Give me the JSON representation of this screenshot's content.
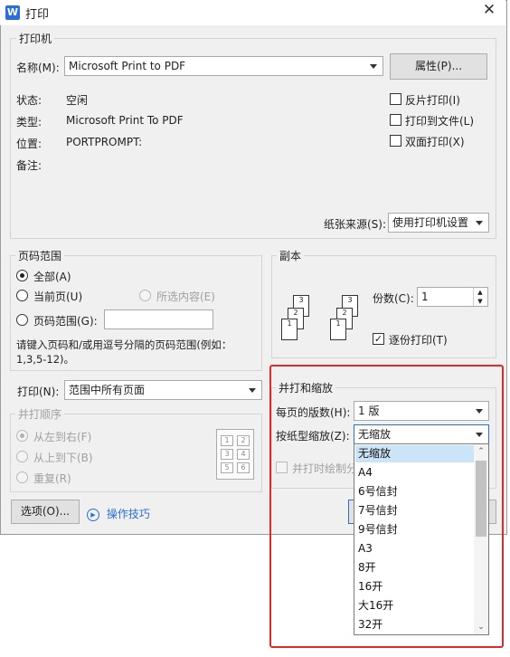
{
  "window": {
    "title": "打印",
    "app_icon": "W",
    "close_glyph": "✕"
  },
  "printer": {
    "group_label": "打印机",
    "name_label": "名称(M):",
    "name_value": "Microsoft Print to PDF",
    "properties_button": "属性(P)...",
    "status_label": "状态:",
    "status_value": "空闲",
    "type_label": "类型:",
    "type_value": "Microsoft Print To PDF",
    "location_label": "位置:",
    "location_value": "PORTPROMPT:",
    "comment_label": "备注:",
    "checks": [
      "反片打印(I)",
      "打印到文件(L)",
      "双面打印(X)"
    ],
    "paper_source_label": "纸张来源(S):",
    "paper_source_value": "使用打印机设置"
  },
  "page_range": {
    "group_label": "页码范围",
    "all": "全部(A)",
    "current": "当前页(U)",
    "selection": "所选内容(E)",
    "range": "页码范围(G):",
    "hint": "请键入页码和/或用逗号分隔的页码范围(例如：",
    "hint2": "1,3,5-12)。"
  },
  "copies": {
    "group_label": "副本",
    "count_label": "份数(C):",
    "count_value": "1",
    "collate_label": "逐份打印(T)",
    "collate_checked": true
  },
  "print_what": {
    "label": "打印(N):",
    "value": "范围中所有页面"
  },
  "order": {
    "group_label": "并打顺序",
    "left_right": "从左到右(F)",
    "top_bottom": "从上到下(B)",
    "repeat": "重复(R)"
  },
  "order_preview_numbers": [
    "1",
    "2",
    "3",
    "4",
    "5",
    "6"
  ],
  "zoom": {
    "group_label": "并打和缩放",
    "pages_per_sheet_label": "每页的版数(H):",
    "pages_per_sheet_value": "1 版",
    "scale_label": "按纸型缩放(Z):",
    "scale_value": "无缩放",
    "draw_borders_label": "并打时绘制分"
  },
  "scale_options": [
    "无缩放",
    "A4",
    "6号信封",
    "7号信封",
    "9号信封",
    "A3",
    "8开",
    "16开",
    "大16开",
    "32开"
  ],
  "footer": {
    "options_button": "选项(O)...",
    "tips_label": "操作技巧"
  },
  "colors": {
    "accent": "#2b6fd6",
    "highlight": "#cce4f7",
    "annotation_red": "#e02a2a"
  }
}
